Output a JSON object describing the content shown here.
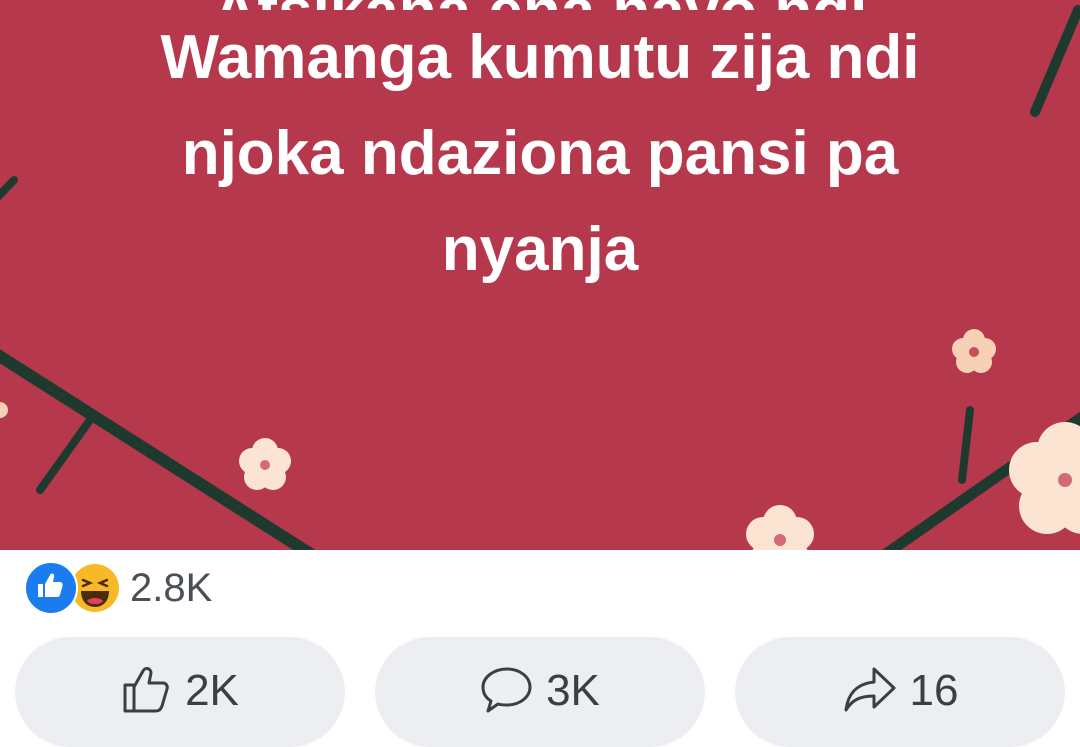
{
  "post": {
    "caption_top_partial": "Atsikana ena nayo ndi amsonda,",
    "caption_lines": [
      "Wamanga kumutu zija ndi",
      "njoka  ndaziona pansi pa",
      "nyanja"
    ],
    "background_color": "#b5384c"
  },
  "reactions": {
    "icons": [
      "like-icon",
      "haha-icon"
    ],
    "count": "2.8K"
  },
  "actions": {
    "like": {
      "icon": "thumbs-up-icon",
      "label": "2K"
    },
    "comment": {
      "icon": "comment-icon",
      "label": "3K"
    },
    "share": {
      "icon": "share-icon",
      "label": "16"
    }
  }
}
